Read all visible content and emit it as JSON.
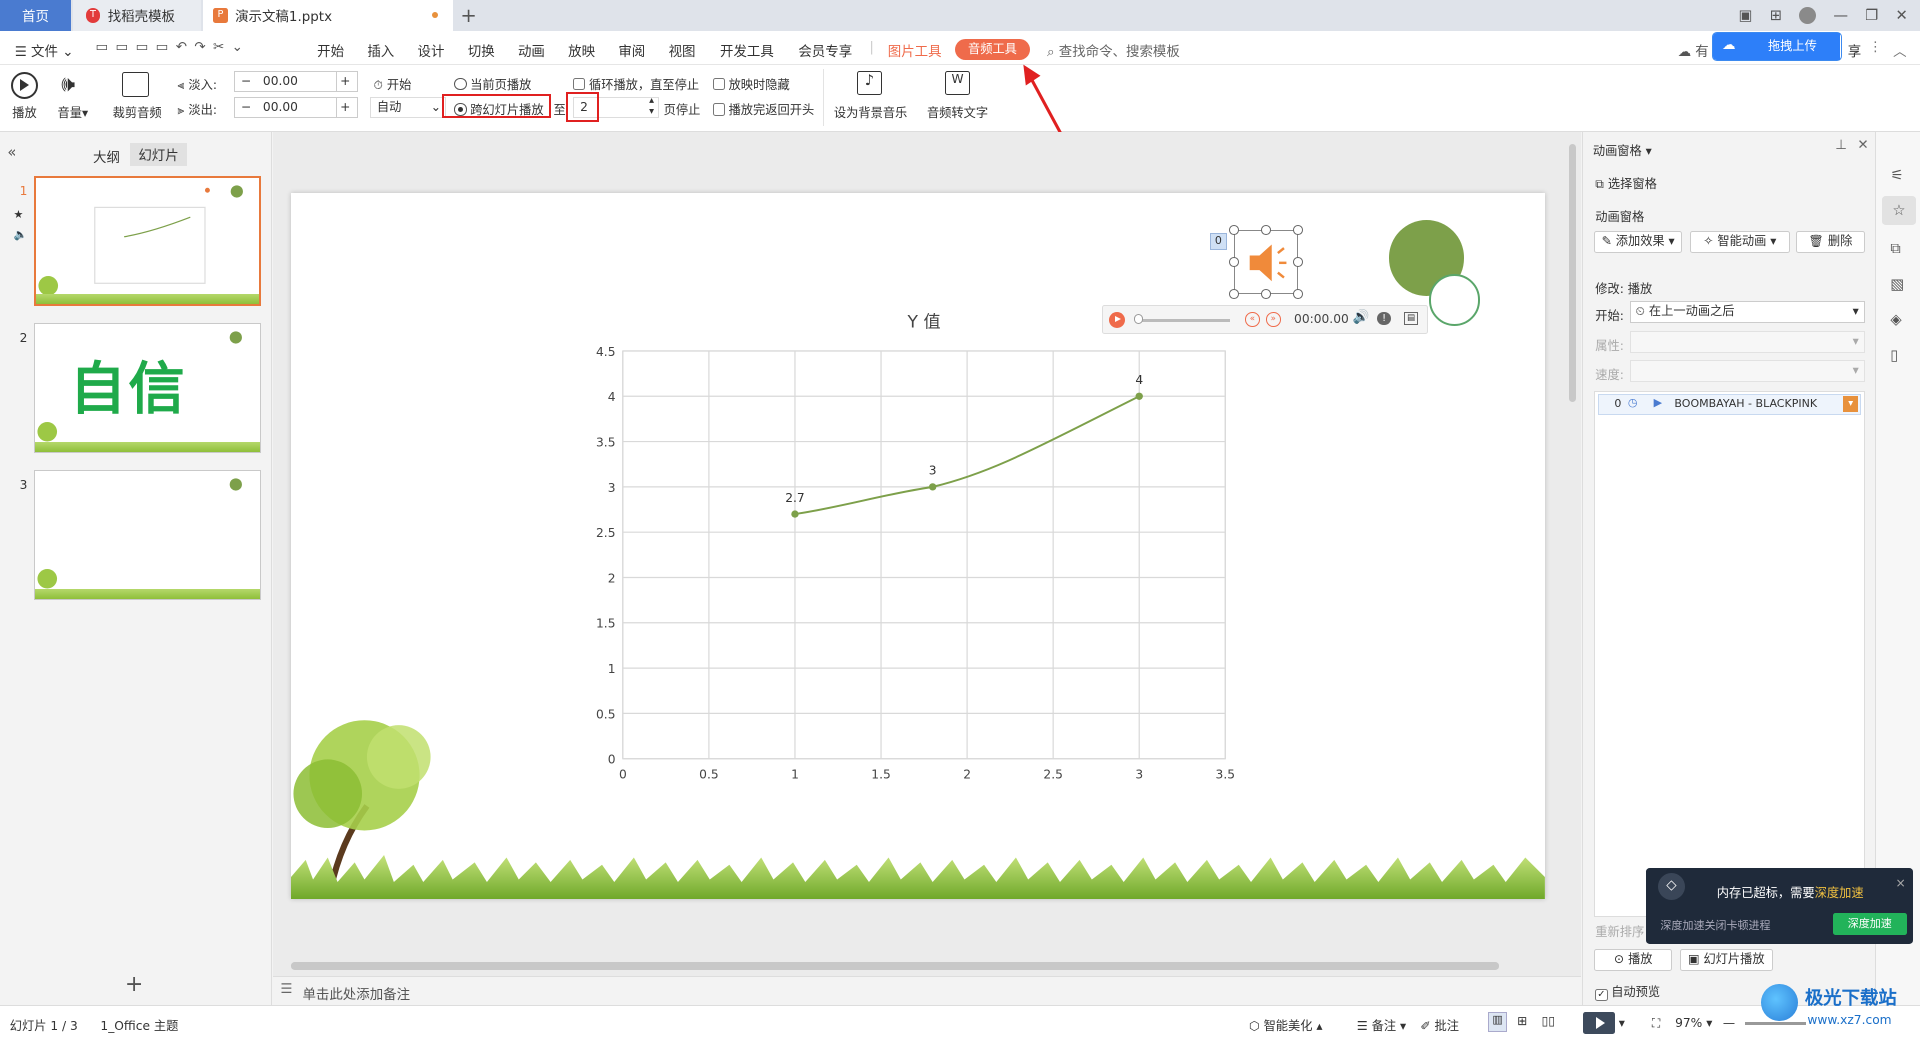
{
  "tabs": {
    "home": "首页",
    "template": "找稻壳模板",
    "doc": "演示文稿1.pptx",
    "template_icon": "T",
    "doc_icon": "P"
  },
  "menu": {
    "file": "文件",
    "items": [
      "开始",
      "插入",
      "设计",
      "切换",
      "动画",
      "放映",
      "审阅",
      "视图",
      "开发工具",
      "会员专享"
    ],
    "picture_tools": "图片工具",
    "audio_tools": "音频工具",
    "search": "查找命令、搜索模板",
    "upload": "拖拽上传",
    "share_prefix": "有",
    "more_label": "享"
  },
  "ribbon": {
    "play": "播放",
    "volume": "音量",
    "trim": "裁剪音频",
    "fade_in_label": "淡入:",
    "fade_in_value": "00.00",
    "fade_out_label": "淡出:",
    "fade_out_value": "00.00",
    "start_label": "开始",
    "start_value": "自动",
    "current_page": "当前页播放",
    "cross_slides": "跨幻灯片播放",
    "to": "至",
    "page_value": "2",
    "page_stop": "页停止",
    "loop": "循环播放，直至停止",
    "hide": "放映时隐藏",
    "rewind": "播放完返回开头",
    "bg_music": "设为背景音乐",
    "to_text": "音频转文字"
  },
  "left": {
    "outline": "大纲",
    "slides": "幻灯片",
    "add": "+",
    "thumbs": [
      {
        "num": "1"
      },
      {
        "num": "2",
        "text": "自信"
      },
      {
        "num": "3"
      }
    ]
  },
  "slide": {
    "audio_tag": "0",
    "time": "00:00.00"
  },
  "chart_data": {
    "type": "line",
    "title": "Y 值",
    "x": [
      1,
      1.8,
      3
    ],
    "y": [
      2.7,
      3,
      4
    ],
    "data_labels": [
      "2.7",
      "3",
      "4"
    ],
    "xlim": [
      0,
      3.5
    ],
    "ylim": [
      0,
      4.5
    ],
    "xticks": [
      "0",
      "0.5",
      "1",
      "1.5",
      "2",
      "2.5",
      "3",
      "3.5"
    ],
    "yticks": [
      "0",
      "0.5",
      "1",
      "1.5",
      "2",
      "2.5",
      "3",
      "3.5",
      "4",
      "4.5"
    ],
    "grid": true,
    "line_color": "#7da04a"
  },
  "right": {
    "title": "动画窗格",
    "select_pane": "选择窗格",
    "anim_pane": "动画窗格",
    "add_effect": "添加效果",
    "smart_anim": "智能动画",
    "delete": "删除",
    "modify": "修改: 播放",
    "start_label": "开始:",
    "start_value": "在上一动画之后",
    "prop_label": "属性:",
    "speed_label": "速度:",
    "item_num": "0",
    "item_name": "BOOMBAYAH - BLACKPINK",
    "reorder": "重新排序",
    "play_btn": "播放",
    "slideshow_btn": "幻灯片播放",
    "autopreview": "自动预览"
  },
  "toast": {
    "title": "内存已超标，需要",
    "title_link": "深度加速",
    "desc": "深度加速关闭卡顿进程",
    "button": "深度加速",
    "close": "×"
  },
  "notes": "单击此处添加备注",
  "status": {
    "slide": "幻灯片 1 / 3",
    "theme": "1_Office 主题",
    "beautify": "智能美化",
    "notes_btn": "备注",
    "comment": "批注",
    "zoom": "97%"
  },
  "watermark": {
    "name": "极光下载站",
    "url": "www.xz7.com"
  },
  "colors": {
    "accent": "#e8793c",
    "audio_pill": "#ef6b4b",
    "green": "#7da04a",
    "red_box": "#e02020"
  }
}
